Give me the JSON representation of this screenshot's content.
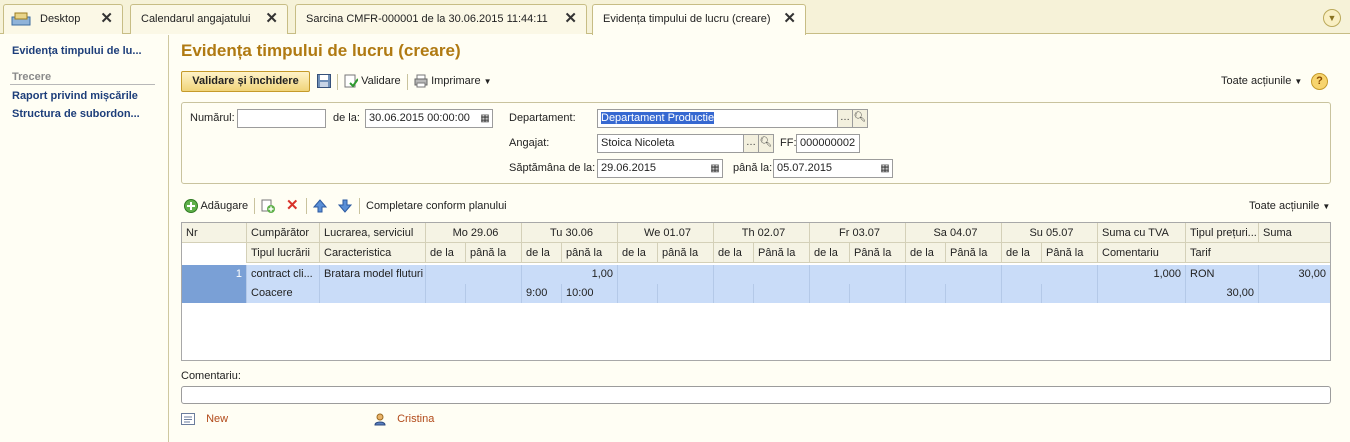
{
  "tabs": [
    {
      "label": "Desktop"
    },
    {
      "label": "Calendarul angajatului"
    },
    {
      "label": "Sarcina CMFR-000001 de la 30.06.2015 11:44:11"
    },
    {
      "label": "Evidența timpului de lucru (creare)"
    }
  ],
  "sidebar": {
    "current": "Evidența timpului de lu...",
    "group": "Trecere",
    "links": [
      "Raport privind mișcările",
      "Structura de subordon..."
    ]
  },
  "page": {
    "title": "Evidența timpului de lucru (creare)"
  },
  "toolbar": {
    "validate_close": "Validare și închidere",
    "validate": "Validare",
    "print": "Imprimare",
    "all_actions": "Toate acțiunile",
    "help": "?"
  },
  "form": {
    "number_label": "Numărul:",
    "number_value": "",
    "date_label": "de la:",
    "date_value": "30.06.2015 00:00:00",
    "department_label": "Departament:",
    "department_value": "Departament Productie",
    "employee_label": "Angajat:",
    "employee_value": "Stoica Nicoleta",
    "ff_label": "FF:",
    "ff_value": "000000002",
    "week_label": "Săptămâna de la:",
    "week_from": "29.06.2015",
    "week_to_label": "până la:",
    "week_to": "05.07.2015"
  },
  "table_toolbar": {
    "add": "Adăugare",
    "fill_plan": "Completare conform planului",
    "all_actions": "Toate acțiunile"
  },
  "table": {
    "header1": [
      "Nr",
      "Cumpărător",
      "Lucrarea, serviciul",
      "Mo 29.06",
      "Tu 30.06",
      "We 01.07",
      "Th 02.07",
      "Fr 03.07",
      "Sa 04.07",
      "Su 05.07",
      "Suma cu TVA",
      "Tipul prețuri...",
      "Suma"
    ],
    "header2": [
      "Tipul lucrării",
      "Caracteristica",
      "de la",
      "până la",
      "de la",
      "până la",
      "de la",
      "până la",
      "de la",
      "Până la",
      "de la",
      "Până la",
      "de la",
      "Până la",
      "de la",
      "Până la",
      "Comentariu",
      "Tarif"
    ],
    "row": {
      "nr": "1",
      "buyer": "contract cli...",
      "work": "Bratara model fluturi",
      "tu_hours": "1,00",
      "sum_vat": "1,000",
      "price_type": "RON",
      "sum": "30,00",
      "work_type": "Coacere",
      "tu_from": "9:00",
      "tu_to": "10:00",
      "tariff": "30,00"
    }
  },
  "comment": {
    "label": "Comentariu:",
    "value": ""
  },
  "footer": {
    "status": "New",
    "author": "Cristina"
  }
}
